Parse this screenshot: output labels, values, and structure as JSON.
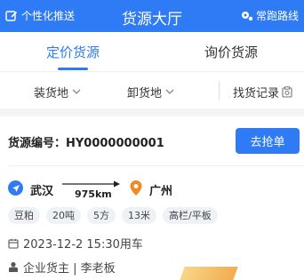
{
  "header": {
    "push_label": "个性化推送",
    "title": "货源大厅",
    "routes_label": "常跑路线"
  },
  "tabs": [
    {
      "label": "定价货源",
      "active": true
    },
    {
      "label": "询价货源",
      "active": false
    }
  ],
  "filters": {
    "load_place": "装货地",
    "unload_place": "卸货地",
    "history_label": "找货记录"
  },
  "card": {
    "source_no_label": "货源编号：HY0000000001",
    "grab_button": "去抢单",
    "from_city": "武汉",
    "distance": "975km",
    "to_city": "广州",
    "tags": [
      "豆粕",
      "20吨",
      "5方",
      "13米",
      "高栏/平板"
    ],
    "datetime": "2023-12-2 15:30用车",
    "owner": "企业货主 | 李老板"
  },
  "colors": {
    "brand": "#2f7bf5",
    "destination": "#f08a24"
  }
}
